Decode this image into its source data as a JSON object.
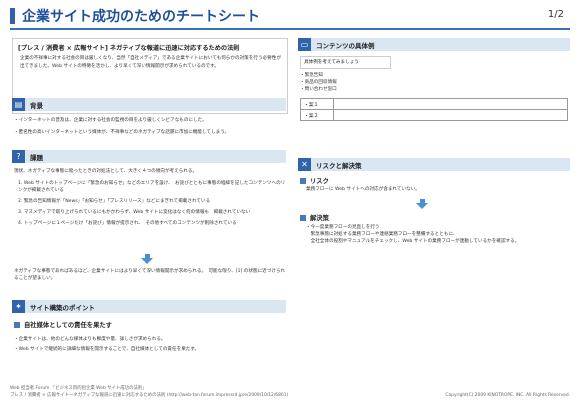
{
  "header": {
    "title": "企業サイト成功のためのチートシート",
    "page": "1/2"
  },
  "intro": {
    "title": "[プレス / 消費者 × 広報サイト] ネガティブな報道に迅速に対応するための法則",
    "body": "企業の不祥事に対する社会の目は厳しくなり、当然「自社メディア」である企業サイトにおいても何らかの対策を行う必要性が出てきました。Web サイトの特徴を活かし、より早くて深い情報開示が求められているのです。"
  },
  "background": {
    "label": "背景",
    "items": [
      "・インターネットの普及は、企業に対する社会の監視の目をより厳しくシビアなものにした。",
      "・匿名性の高いインターネットという媒体が、不祥事などのネガティブな話題に市加に機能してしまう。"
    ]
  },
  "issues": {
    "label": "課題",
    "lead": "現状、ネガティブな事態に陥ったときの対処法として、大きく４つの傾向が考えられる。",
    "items": [
      "1. Web サイトのトップページに「緊急のお知らせ」などのエリアを設け、　お詫びとともに事態の経緯を記したコンテンツへのリンクが掲載されている",
      "2. 緊急の告知情報が「News」「お知らせ」「プレスリリース」などにまぎれて掲載されている",
      "3. マスメディアで取り上げられているにもかかわらず、Web サイトに変化はなく何の情報も　掲載されていない",
      "4. トップページに１ページだけ「お詫び」情報が提示され、　その他すべてのコンテンツが削除されている"
    ],
    "conclusion": "ネガティブな事態であればあるほど、企業サイトにはより早くて深い情報開示が求められる。　可能な限り、[1] の状態に近づけられることが望ましい。"
  },
  "points": {
    "label": "サイト構築のポイント",
    "sub": "自社媒体としての責任を果たす",
    "items": [
      "・企業サイトは、他のどんな媒体よりも鮮度や量、詳しさが求められる。",
      "・Web サイトで継続的に詳細な情報を開示することで、自社媒体としての責任を果たす。"
    ]
  },
  "contents": {
    "label": "コンテンツの具体例",
    "think_label": "具体例を考えてみましょう",
    "items": [
      "・緊急告知",
      "・商品の回収情報",
      "・問い合わせ窓口"
    ],
    "rows": [
      "・案１",
      "・案２"
    ]
  },
  "risk": {
    "label": "リスクと解決策",
    "risk_title": "リスク",
    "risk_text": "業務フローに Web サイトへの対応が含まれていない。",
    "solution_title": "解決策",
    "solution_items": [
      "・今一度業務フローの見直しを行う",
      "　緊急事態に対処する業務フローや連絡業務フローを整備するとともに、",
      "　全社全体の役割やマニュアルをチェックし、Web サイトの業務フローが連動しているかを確認する。"
    ]
  },
  "footer": {
    "line1": "Web 担当者 Forum 「ビジネス目的別企業 Web サイト成功の法則」",
    "line2": "プレス / 消費者 × 広報サイト―ネガティブな報道に迅速に対応するための法則 (http://web-tan.forum.impressrd.jp/e/2009/10/12/6801)",
    "copyright": "Copyright(C) 2009 KINOTROPE, INC. All Rights Reserved."
  }
}
